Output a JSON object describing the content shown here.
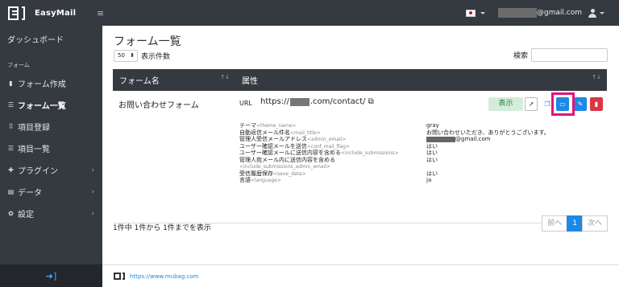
{
  "app": {
    "name": "EasyMail"
  },
  "topbar": {
    "email_suffix": "@gmail.com"
  },
  "sidebar": {
    "dashboard": "ダッシュボード",
    "heading": "フォーム",
    "items": [
      {
        "label": "フォーム作成",
        "icon": "file-icon"
      },
      {
        "label": "フォーム一覧",
        "icon": "list-icon"
      },
      {
        "label": "項目登録",
        "icon": "sitemap-icon"
      },
      {
        "label": "項目一覧",
        "icon": "list-icon"
      },
      {
        "label": "プラグイン",
        "icon": "puzzle-icon",
        "chevron": "›"
      },
      {
        "label": "データ",
        "icon": "database-icon",
        "chevron": "›"
      },
      {
        "label": "設定",
        "icon": "gear-icon",
        "chevron": "›"
      }
    ]
  },
  "main": {
    "title": "フォーム一覧",
    "per_page_value": "50",
    "per_page_label": "表示件数",
    "search_label": "検索",
    "table": {
      "col1": "フォーム名",
      "col2": "属性",
      "row": {
        "name": "お問い合わせフォーム",
        "url_label": "URL",
        "url_prefix": "https://",
        "url_suffix": ".com/contact/",
        "show_label": "表示"
      },
      "props": [
        {
          "key": "テーマ",
          "sub": "<theme_name>",
          "value": "gray"
        },
        {
          "key": "自動返信メール件名",
          "sub": "<mail_title>",
          "value": "お問い合わせいただき、ありがとうございます。"
        },
        {
          "key": "管理人受信メールアドレス",
          "sub": "<admin_email>",
          "value": "@gmail.com"
        },
        {
          "key": "ユーザー確認メールを送信",
          "sub": "<conf_mail_flag>",
          "value": "はい"
        },
        {
          "key": "ユーザー確認メールに送信内容を含める",
          "sub": "<include_submissions>",
          "value": "はい"
        },
        {
          "key": "管理人宛メール内に送信内容を含める",
          "sub": "",
          "value": "はい"
        },
        {
          "key": "",
          "sub": "<include_submissions_admin_email>",
          "value": ""
        },
        {
          "key": "受信履歴保存",
          "sub": "<save_data>",
          "value": "はい"
        },
        {
          "key": "言語",
          "sub": "<language>",
          "value": "ja"
        }
      ]
    },
    "info": "1件中 1件から 1件までを表示",
    "pager": {
      "prev": "前へ",
      "page": "1",
      "next": "次へ"
    }
  },
  "footer": {
    "link": "https://www.mubag.com"
  },
  "colors": {
    "sidebar": "#343a40",
    "primary": "#1e88e5",
    "danger": "#dc3545",
    "highlight": "#e6127b"
  }
}
